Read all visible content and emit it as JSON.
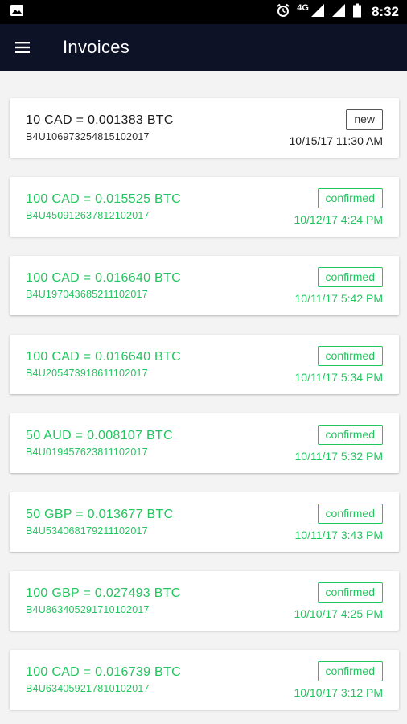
{
  "status_bar": {
    "time": "8:32",
    "network": "4G",
    "icons": [
      "image-icon",
      "alarm-icon",
      "signal-icon",
      "battery-icon"
    ]
  },
  "app_bar": {
    "title": "Invoices",
    "menu_icon": "menu-icon",
    "background": "#0d1226"
  },
  "colors": {
    "confirmed": "#22c55e",
    "new": "#333333"
  },
  "invoices": [
    {
      "amount": "10 CAD = 0.001383 BTC",
      "id": "B4U106973254815102017",
      "status": "new",
      "date": "10/15/17 11:30 AM"
    },
    {
      "amount": "100 CAD = 0.015525 BTC",
      "id": "B4U450912637812102017",
      "status": "confirmed",
      "date": "10/12/17 4:24 PM"
    },
    {
      "amount": "100 CAD = 0.016640 BTC",
      "id": "B4U197043685211102017",
      "status": "confirmed",
      "date": "10/11/17 5:42 PM"
    },
    {
      "amount": "100 CAD = 0.016640 BTC",
      "id": "B4U205473918611102017",
      "status": "confirmed",
      "date": "10/11/17 5:34 PM"
    },
    {
      "amount": "50 AUD = 0.008107 BTC",
      "id": "B4U019457623811102017",
      "status": "confirmed",
      "date": "10/11/17 5:32 PM"
    },
    {
      "amount": "50 GBP = 0.013677 BTC",
      "id": "B4U534068179211102017",
      "status": "confirmed",
      "date": "10/11/17 3:43 PM"
    },
    {
      "amount": "100 GBP = 0.027493 BTC",
      "id": "B4U863405291710102017",
      "status": "confirmed",
      "date": "10/10/17 4:25 PM"
    },
    {
      "amount": "100 CAD = 0.016739 BTC",
      "id": "B4U634059217810102017",
      "status": "confirmed",
      "date": "10/10/17 3:12 PM"
    }
  ]
}
